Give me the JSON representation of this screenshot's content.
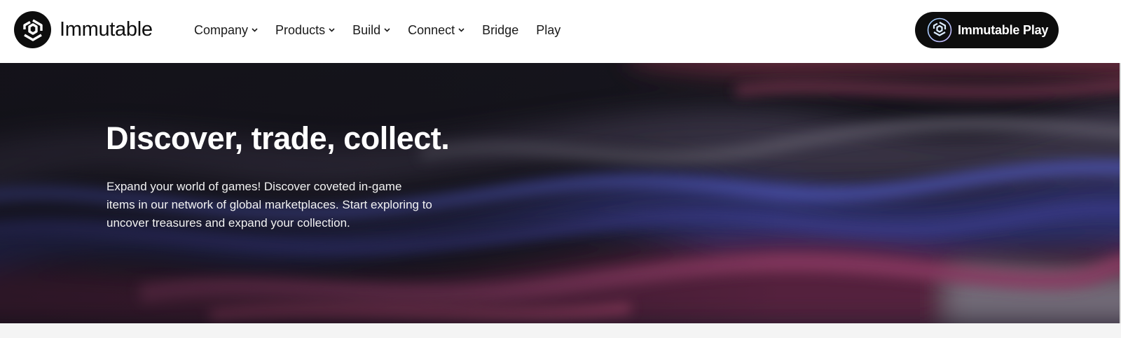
{
  "brand": {
    "name": "Immutable",
    "logo_icon": "immutable-hexagon-logo"
  },
  "nav": {
    "items": [
      {
        "label": "Company",
        "has_dropdown": true
      },
      {
        "label": "Products",
        "has_dropdown": true
      },
      {
        "label": "Build",
        "has_dropdown": true
      },
      {
        "label": "Connect",
        "has_dropdown": true
      },
      {
        "label": "Bridge",
        "has_dropdown": false
      },
      {
        "label": "Play",
        "has_dropdown": false
      }
    ]
  },
  "cta": {
    "label": "Immutable Play",
    "icon": "immutable-play-logo"
  },
  "hero": {
    "title": "Discover, trade, collect.",
    "description": "Expand your world of games! Discover coveted in-game items in our network of global marketplaces. Start exploring to uncover treasures and expand your collection."
  },
  "colors": {
    "header_bg": "#ffffff",
    "text_dark": "#0d0d0d",
    "button_bg": "#0d0d0d",
    "hero_bg": "#15141c",
    "hero_text": "#ffffff",
    "wave_purple": "#3a3f8f",
    "wave_magenta": "#8a2f5a"
  }
}
